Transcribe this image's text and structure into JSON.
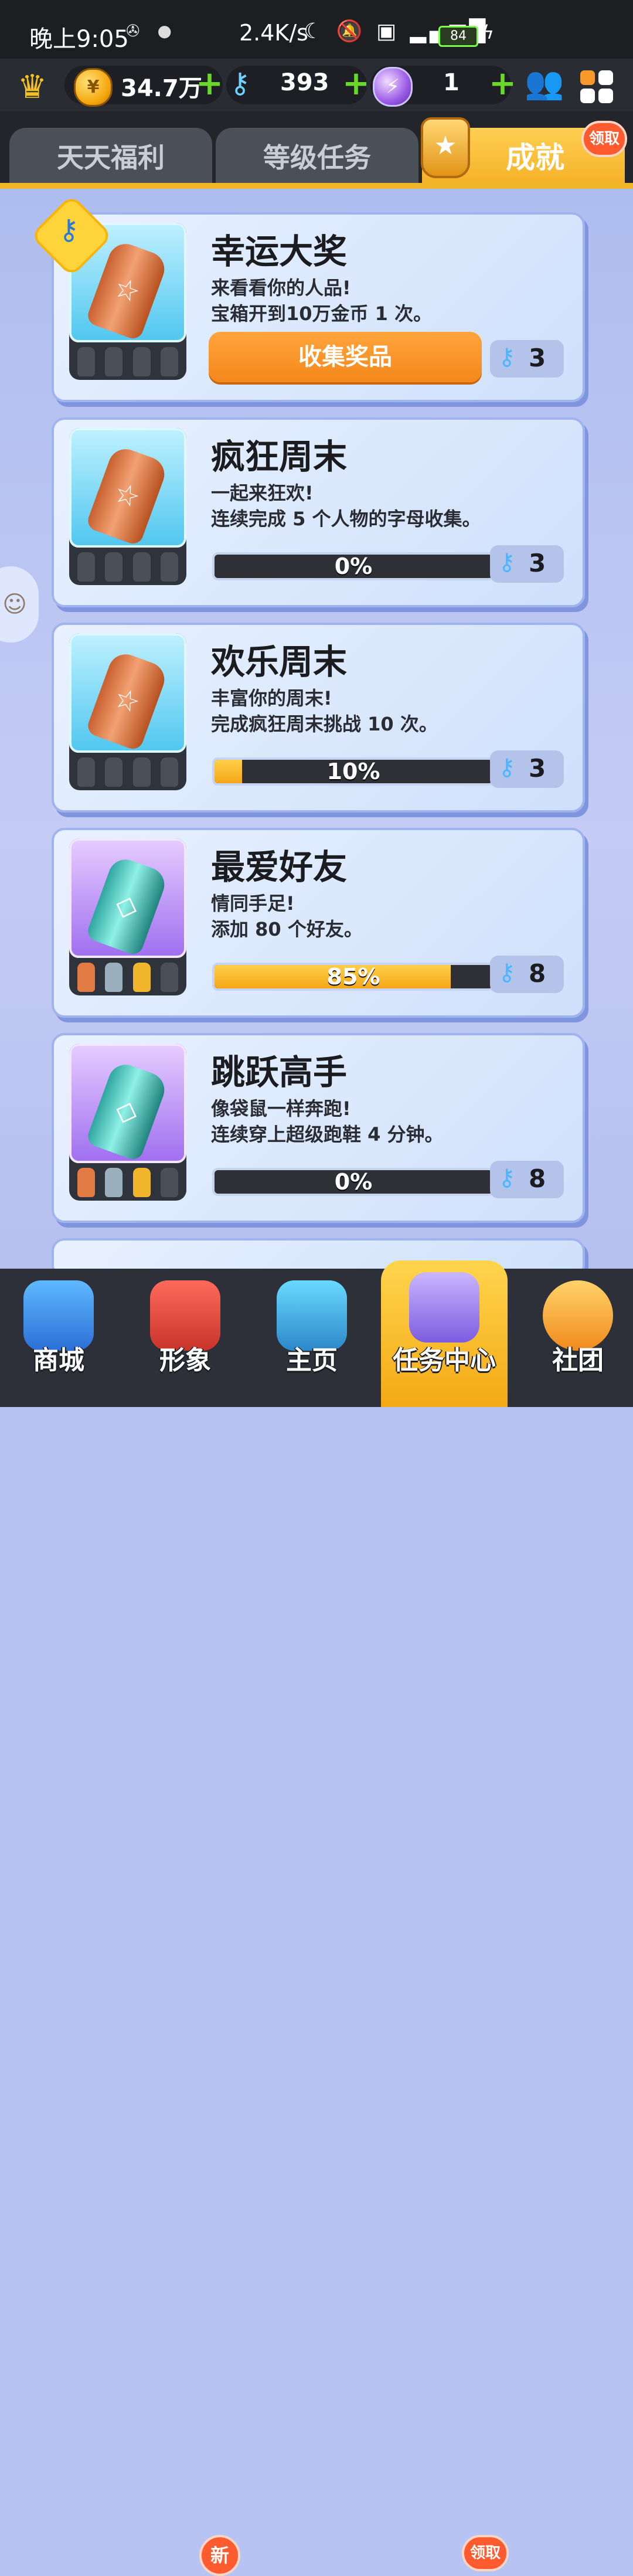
{
  "status_bar": {
    "time": "晚上9:05",
    "speed": "2.4K/s",
    "network": "4G",
    "battery": "84"
  },
  "currency": {
    "coins": "34.7万",
    "keys": "393",
    "tokens": "1"
  },
  "tabs": [
    {
      "label": "天天福利"
    },
    {
      "label": "等级任务"
    },
    {
      "label": "成就",
      "badge": "领取"
    }
  ],
  "achievements": [
    {
      "title": "幸运大奖",
      "desc1": "来看看你的人品!",
      "desc2": "宝箱开到10万金币 1 次。",
      "button": "收集奖品",
      "reward": "3"
    },
    {
      "title": "疯狂周末",
      "desc1": "一起来狂欢!",
      "desc2": "连续完成 5 个人物的字母收集。",
      "progress_text": "0%",
      "progress": 0,
      "reward": "3"
    },
    {
      "title": "欢乐周末",
      "desc1": "丰富你的周末!",
      "desc2": "完成疯狂周末挑战 10 次。",
      "progress_text": "10%",
      "progress": 10,
      "reward": "3"
    },
    {
      "title": "最爱好友",
      "desc1": "情同手足!",
      "desc2": "添加 80 个好友。",
      "progress_text": "85%",
      "progress": 85,
      "reward": "8"
    },
    {
      "title": "跳跃高手",
      "desc1": "像袋鼠一样奔跑!",
      "desc2": "连续穿上超级跑鞋 4 分钟。",
      "progress_text": "0%",
      "progress": 0,
      "reward": "8"
    }
  ],
  "bottom_nav": [
    {
      "label": "商城"
    },
    {
      "label": "形象",
      "badge": "新"
    },
    {
      "label": "主页"
    },
    {
      "label": "任务中心",
      "badge": "领取"
    },
    {
      "label": "社团"
    }
  ],
  "icons": {
    "crown": "crown-icon",
    "coin": "coin-icon",
    "key": "key-icon",
    "token": "token-icon",
    "friends": "friends-icon",
    "menu": "grid-menu-icon"
  },
  "colors": {
    "accent": "#f4a617",
    "badge": "#ff5b2e",
    "progress_bg": "#2e3036"
  }
}
